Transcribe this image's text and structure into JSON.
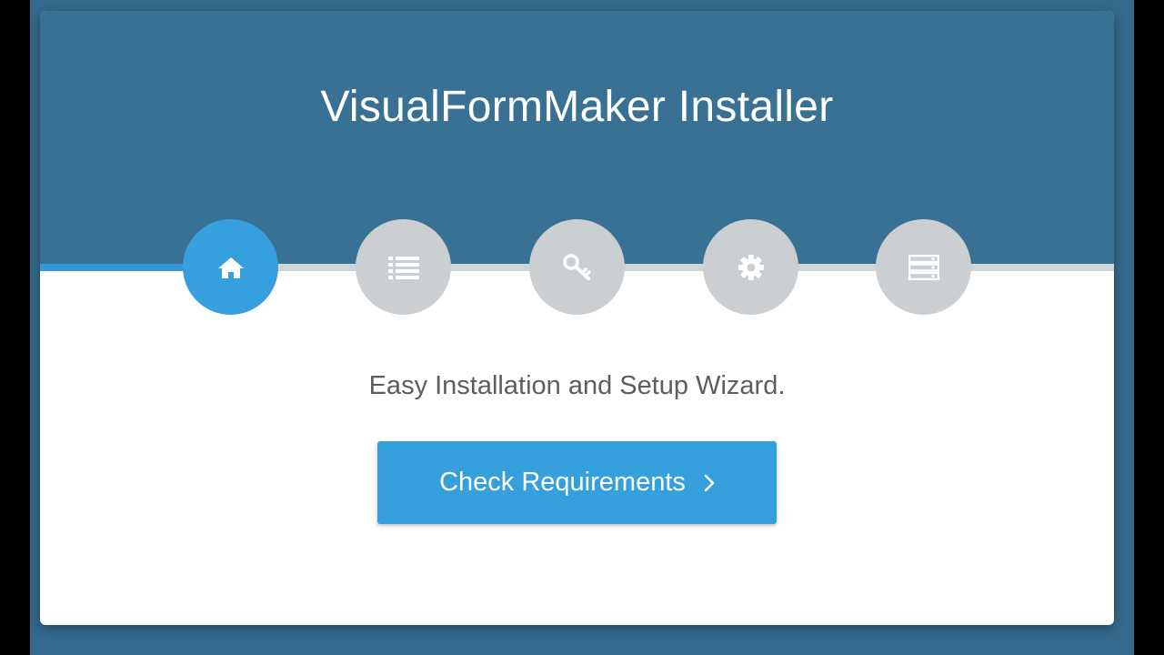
{
  "installer": {
    "title": "VisualFormMaker Installer",
    "subtitle": "Easy Installation and Setup Wizard.",
    "primary_button_label": "Check Requirements"
  },
  "steps": [
    {
      "icon": "home-icon",
      "active": true
    },
    {
      "icon": "list-icon",
      "active": false
    },
    {
      "icon": "key-icon",
      "active": false
    },
    {
      "icon": "gear-icon",
      "active": false
    },
    {
      "icon": "server-icon",
      "active": false
    }
  ],
  "colors": {
    "page_background": "#356a8e",
    "header_background": "#387194",
    "accent": "#36a0de",
    "inactive_step": "#cbcfd2",
    "track": "#cfd4d8"
  }
}
